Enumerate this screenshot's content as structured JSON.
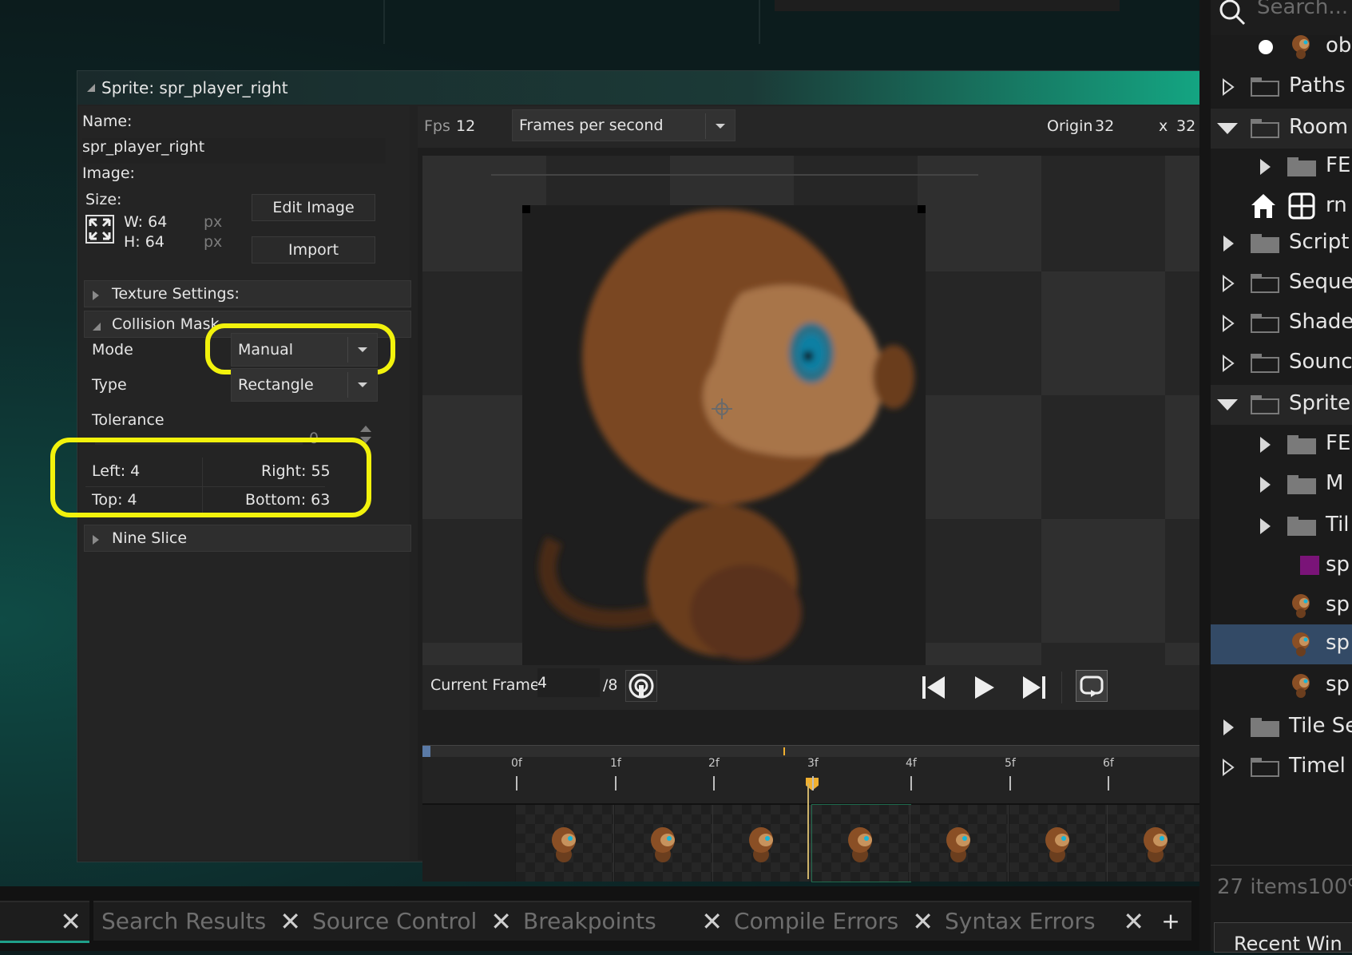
{
  "window": {
    "title": "Sprite: spr_player_right"
  },
  "left_panel": {
    "name_label": "Name:",
    "name_value": "spr_player_right",
    "image_label": "Image:",
    "size_label": "Size:",
    "width": "W: 64",
    "height": "H: 64",
    "unit_w": "px",
    "unit_h": "px",
    "edit_image_button": "Edit Image",
    "import_button": "Import",
    "texture_settings": "Texture Settings:",
    "collision_mask": "Collision Mask",
    "mode_label": "Mode",
    "mode_value": "Manual",
    "type_label": "Type",
    "type_value": "Rectangle",
    "tolerance_label": "Tolerance",
    "tolerance_value": "0",
    "left": "Left: 4",
    "right": "Right: 55",
    "top": "Top: 4",
    "bottom": "Bottom: 63",
    "nine_slice": "Nine Slice"
  },
  "toolbar": {
    "fps_label": "Fps",
    "fps_value": "12",
    "fps_mode": "Frames per second",
    "origin_label": "Origin",
    "origin_x": "32",
    "origin_sep": "x",
    "origin_y": "32"
  },
  "frame_bar": {
    "current_frame_label": "Current Frame:",
    "current_frame_value": "4",
    "frame_total": "/8"
  },
  "timeline": {
    "ticks": [
      "0f",
      "1f",
      "2f",
      "3f",
      "4f",
      "5f",
      "6f"
    ],
    "frame_count_visible": 7
  },
  "asset_browser": {
    "search_placeholder": "Search...",
    "rows": [
      {
        "name": "ob",
        "type": "object"
      },
      {
        "name": "Paths",
        "type": "folder"
      },
      {
        "name": "Room",
        "type": "folder"
      },
      {
        "name": "FE",
        "type": "folder"
      },
      {
        "name": "rn",
        "type": "room"
      },
      {
        "name": "Script",
        "type": "folder"
      },
      {
        "name": "Seque",
        "type": "folder"
      },
      {
        "name": "Shade",
        "type": "folder"
      },
      {
        "name": "Sounc",
        "type": "folder"
      },
      {
        "name": "Sprite",
        "type": "folder"
      },
      {
        "name": "FE",
        "type": "folder"
      },
      {
        "name": "M",
        "type": "folder"
      },
      {
        "name": "Til",
        "type": "folder"
      },
      {
        "name": "sp",
        "type": "sprite"
      },
      {
        "name": "sp",
        "type": "sprite"
      },
      {
        "name": "sp",
        "type": "sprite"
      },
      {
        "name": "sp",
        "type": "sprite"
      },
      {
        "name": "Tile Se",
        "type": "folder"
      },
      {
        "name": "Timel",
        "type": "folder"
      }
    ],
    "item_count": "27 items100%",
    "recent_windows": "Recent Win"
  },
  "bottom_tabs": [
    {
      "label": ""
    },
    {
      "label": "Search Results"
    },
    {
      "label": "Source Control"
    },
    {
      "label": "Breakpoints"
    },
    {
      "label": "Compile Errors"
    },
    {
      "label": "Syntax Errors"
    }
  ],
  "bottom_add": "+",
  "colors": {
    "highlight": "#f2f20c",
    "accent_green": "#14a582",
    "playhead": "#f0b030",
    "selected_row": "#334a66"
  }
}
